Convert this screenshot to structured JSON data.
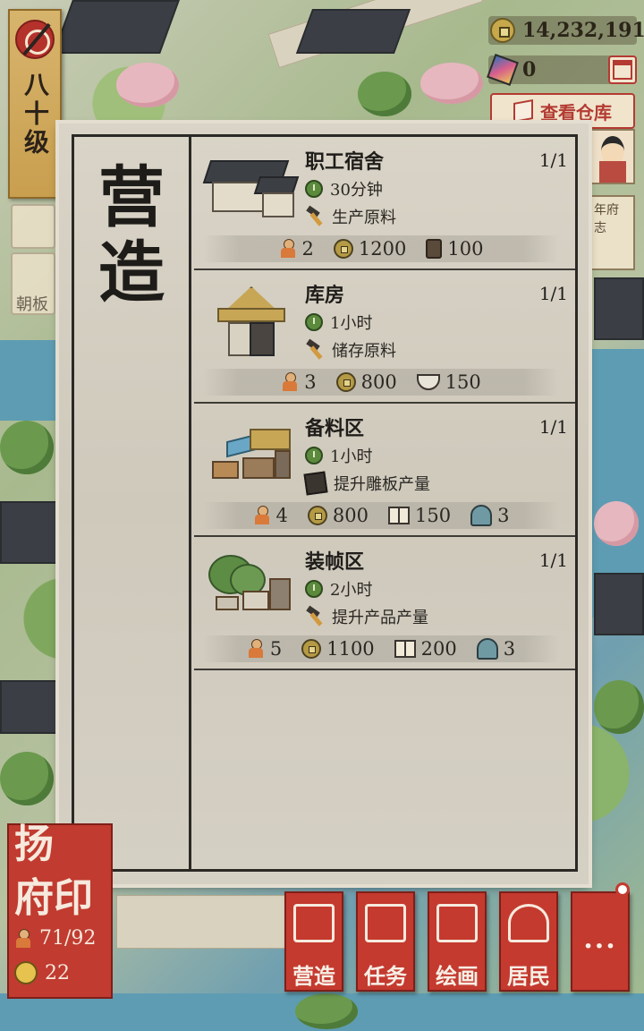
{
  "player": {
    "level": "八十级"
  },
  "currency": {
    "coins": "14,232,191",
    "gems": "0",
    "warehouse_label": "查看仓库"
  },
  "side": {
    "board_label": "朝板",
    "chronicle_label": "年府志"
  },
  "panel": {
    "title": "营造",
    "buildings": [
      {
        "name": "职工宿舍",
        "count": "1/1",
        "time": "30分钟",
        "effect": "生产原料",
        "effect_icon": "hammer-icon",
        "costs": [
          {
            "icon": "worker-icon",
            "value": "2"
          },
          {
            "icon": "coin-icon",
            "value": "1200"
          },
          {
            "icon": "wood-icon",
            "value": "100"
          }
        ]
      },
      {
        "name": "库房",
        "count": "1/1",
        "time": "1小时",
        "effect": "储存原料",
        "effect_icon": "hammer-icon",
        "costs": [
          {
            "icon": "worker-icon",
            "value": "3"
          },
          {
            "icon": "coin-icon",
            "value": "800"
          },
          {
            "icon": "bowl-icon",
            "value": "150"
          }
        ]
      },
      {
        "name": "备料区",
        "count": "1/1",
        "time": "1小时",
        "effect": "提升雕板产量",
        "effect_icon": "board-icon",
        "costs": [
          {
            "icon": "worker-icon",
            "value": "4"
          },
          {
            "icon": "coin-icon",
            "value": "800"
          },
          {
            "icon": "book-icon",
            "value": "150"
          },
          {
            "icon": "bell-icon",
            "value": "3"
          }
        ]
      },
      {
        "name": "装帧区",
        "count": "1/1",
        "time": "2小时",
        "effect": "提升产品产量",
        "effect_icon": "hammer-up-icon",
        "costs": [
          {
            "icon": "worker-icon",
            "value": "5"
          },
          {
            "icon": "coin-icon",
            "value": "1100"
          },
          {
            "icon": "book-icon",
            "value": "200"
          },
          {
            "icon": "bell-icon",
            "value": "3"
          }
        ]
      }
    ]
  },
  "city": {
    "stamp_line1": "扬",
    "stamp_line2": "府印",
    "population": "71/92",
    "happiness": "22"
  },
  "nav": {
    "build": "营造",
    "tasks": "任务",
    "paint": "绘画",
    "residents": "居民",
    "more": "···"
  },
  "colors": {
    "accent_red": "#c43a2f",
    "panel_bg": "#d5d0c4",
    "gold": "#c99f4f"
  }
}
